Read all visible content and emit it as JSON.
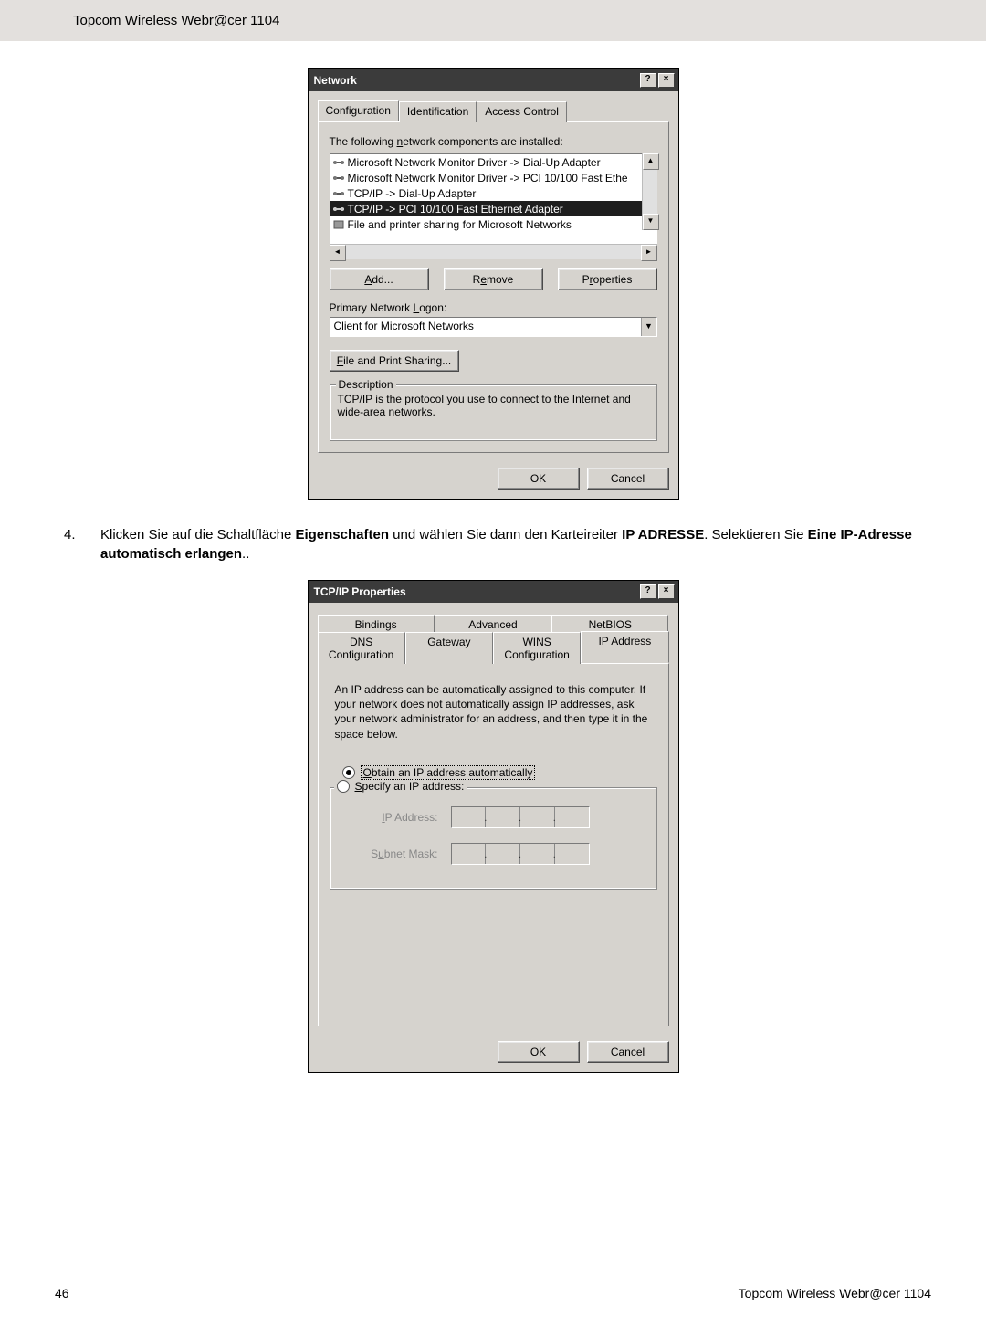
{
  "header": {
    "title": "Topcom Wireless Webr@cer 1104"
  },
  "dialog1": {
    "title": "Network",
    "tabs": [
      "Configuration",
      "Identification",
      "Access Control"
    ],
    "installed_label": "The following network components are installed:",
    "items": [
      "Microsoft Network Monitor Driver -> Dial-Up Adapter",
      "Microsoft Network Monitor Driver -> PCI 10/100 Fast Ethe",
      "TCP/IP -> Dial-Up Adapter",
      "TCP/IP -> PCI 10/100 Fast Ethernet Adapter",
      "File and printer sharing for Microsoft Networks"
    ],
    "selected_index": 3,
    "buttons": {
      "add": "Add...",
      "remove": "Remove",
      "properties": "Properties"
    },
    "logon_label": "Primary Network Logon:",
    "logon_value": "Client for Microsoft Networks",
    "file_print": "File and Print Sharing...",
    "desc_legend": "Description",
    "desc_text": "TCP/IP is the protocol you use to connect to the Internet and wide-area networks.",
    "ok": "OK",
    "cancel": "Cancel"
  },
  "step4": {
    "num": "4.",
    "pre": "Klicken Sie auf die Schaltfläche ",
    "b1": "Eigenschaften",
    "mid1": " und wählen Sie dann den Karteireiter ",
    "b2": "IP ADRESSE",
    "mid2": ". Selektieren Sie ",
    "b3": "Eine IP-Adresse automatisch erlangen",
    "tail": ".."
  },
  "dialog2": {
    "title": "TCP/IP Properties",
    "row1_tabs": [
      "Bindings",
      "Advanced",
      "NetBIOS"
    ],
    "row2_tabs": [
      "DNS Configuration",
      "Gateway",
      "WINS Configuration",
      "IP Address"
    ],
    "active_tab": "IP Address",
    "intro": "An IP address can be automatically assigned to this computer. If your network does not automatically assign IP addresses, ask your network administrator for an address, and then type it in the space below.",
    "radio_obtain": "Obtain an IP address automatically",
    "radio_specify": "Specify an IP address:",
    "ip_label": "IP Address:",
    "mask_label": "Subnet Mask:",
    "ok": "OK",
    "cancel": "Cancel"
  },
  "footer": {
    "page": "46",
    "right": "Topcom Wireless Webr@cer 1104"
  }
}
